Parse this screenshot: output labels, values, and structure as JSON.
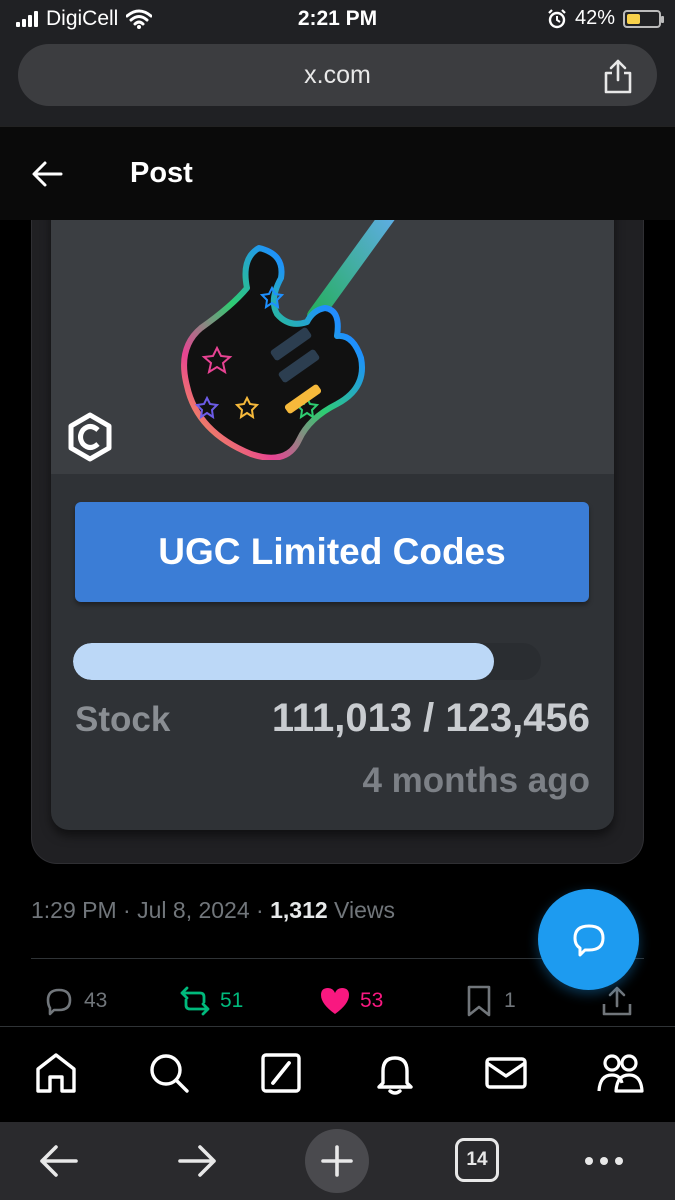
{
  "status_bar": {
    "carrier": "DigiCell",
    "time": "2:21 PM",
    "battery_percent_label": "42%",
    "battery_level": 0.42,
    "icons": [
      "signal-icon",
      "wifi-icon",
      "alarm-icon",
      "battery-icon"
    ]
  },
  "browser": {
    "url": "x.com",
    "open_tabs": "14",
    "icons": [
      "share-icon",
      "back-arrow-icon",
      "forward-arrow-icon",
      "plus-icon",
      "tabs-icon",
      "more-icon"
    ]
  },
  "header": {
    "title": "Post",
    "back_icon": "back-arrow-icon"
  },
  "card": {
    "button_label": "UGC Limited Codes",
    "stock_label": "Stock",
    "stock_value": "111,013 / 123,456",
    "stock_fraction": 0.899,
    "time_ago": "4 months ago",
    "image": "rainbow-guitar-illustration",
    "logo": "brand-logo"
  },
  "post_meta": {
    "time": "1:29 PM",
    "separator": "·",
    "date": "Jul 8, 2024",
    "views_count": "1,312",
    "views_label": "Views"
  },
  "actions": {
    "replies": "43",
    "reposts": "51",
    "likes": "53",
    "bookmarks": "1"
  },
  "colors": {
    "accent_blue": "#1d9bf0",
    "repost_green": "#00ba7c",
    "like_pink": "#f91880",
    "ugc_button_blue": "#3b7dd6"
  },
  "tabbar": {
    "icons": [
      "home-icon",
      "search-icon",
      "grok-icon",
      "notifications-icon",
      "messages-icon",
      "communities-icon"
    ]
  }
}
